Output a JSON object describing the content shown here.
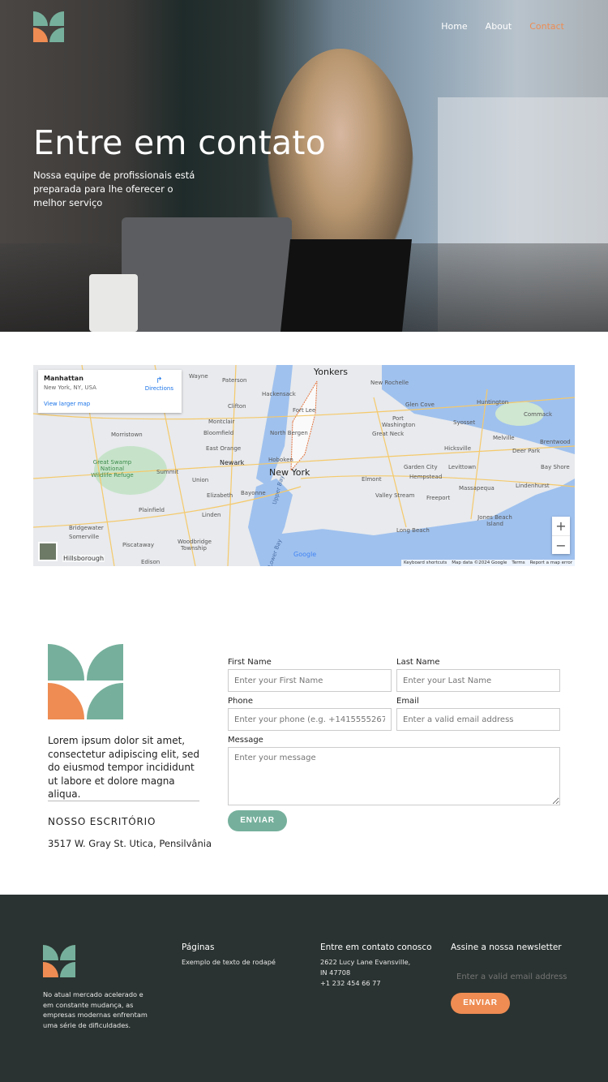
{
  "nav": {
    "items": [
      {
        "label": "Home"
      },
      {
        "label": "About"
      },
      {
        "label": "Contact"
      }
    ]
  },
  "hero": {
    "title": "Entre em contato",
    "subtitle": "Nossa equipe de profissionais está preparada para lhe oferecer o melhor serviço"
  },
  "map": {
    "place": "Manhattan",
    "address": "New York, NY, USA",
    "directions": "Directions",
    "view_larger": "View larger map",
    "labels": [
      "Yonkers",
      "New Rochelle",
      "Paterson",
      "Wayne",
      "Hackensack",
      "Clifton",
      "Fort Lee",
      "Montclair",
      "Bloomfield",
      "North Bergen",
      "Morristown",
      "East Orange",
      "Newark",
      "Hoboken",
      "New York",
      "Summit",
      "Union",
      "Elizabeth",
      "Bayonne",
      "Great Swamp National Wildlife Refuge",
      "Plainfield",
      "Linden",
      "Bridgewater",
      "Somerville",
      "Piscataway",
      "Woodbridge Township",
      "Edison",
      "Hillsborough",
      "Glen Cove",
      "Port Washington",
      "Great Neck",
      "Huntington",
      "Syosset",
      "Commack",
      "Melville",
      "Hicksville",
      "Brentwood",
      "Deer Park",
      "Garden City",
      "Levittown",
      "Bay Shore",
      "Hempstead",
      "Elmont",
      "Massapequa",
      "Lindenhurst",
      "Valley Stream",
      "Freeport",
      "Jones Beach Island",
      "Long Beach",
      "Upper Bay",
      "Lower Bay"
    ],
    "zoom_in": "+",
    "zoom_out": "−",
    "google": "Google",
    "attribution": [
      "Keyboard shortcuts",
      "Map data ©2024 Google",
      "Terms",
      "Report a map error"
    ]
  },
  "about": {
    "text": "Lorem ipsum dolor sit amet, consectetur adipiscing elit, sed do eiusmod tempor incididunt ut labore et dolore magna aliqua.",
    "office_heading": "NOSSO ESCRITÓRIO",
    "office_address": "3517 W. Gray St. Utica, Pensilvânia"
  },
  "form": {
    "first_name": {
      "label": "First Name",
      "placeholder": "Enter your First Name"
    },
    "last_name": {
      "label": "Last Name",
      "placeholder": "Enter your Last Name"
    },
    "phone": {
      "label": "Phone",
      "placeholder": "Enter your phone (e.g. +14155552675)"
    },
    "email": {
      "label": "Email",
      "placeholder": "Enter a valid email address"
    },
    "message": {
      "label": "Message",
      "placeholder": "Enter your message"
    },
    "submit": "ENVIAR"
  },
  "footer": {
    "about": "No atual mercado acelerado e em constante mudança, as empresas modernas enfrentam uma série de dificuldades.",
    "pages_heading": "Páginas",
    "pages_text": "Exemplo de texto de rodapé",
    "contact_heading": "Entre em contato conosco",
    "contact_address1": "2622 Lucy Lane Evansville,",
    "contact_address2": "IN 47708",
    "contact_phone": "+1 232 454 66 77",
    "newsletter_heading": "Assine a nossa newsletter",
    "newsletter_placeholder": "Enter a valid email address",
    "newsletter_submit": "ENVIAR"
  },
  "colors": {
    "teal": "#76b09c",
    "orange": "#ee8c53",
    "footer_bg": "#2a3331"
  }
}
